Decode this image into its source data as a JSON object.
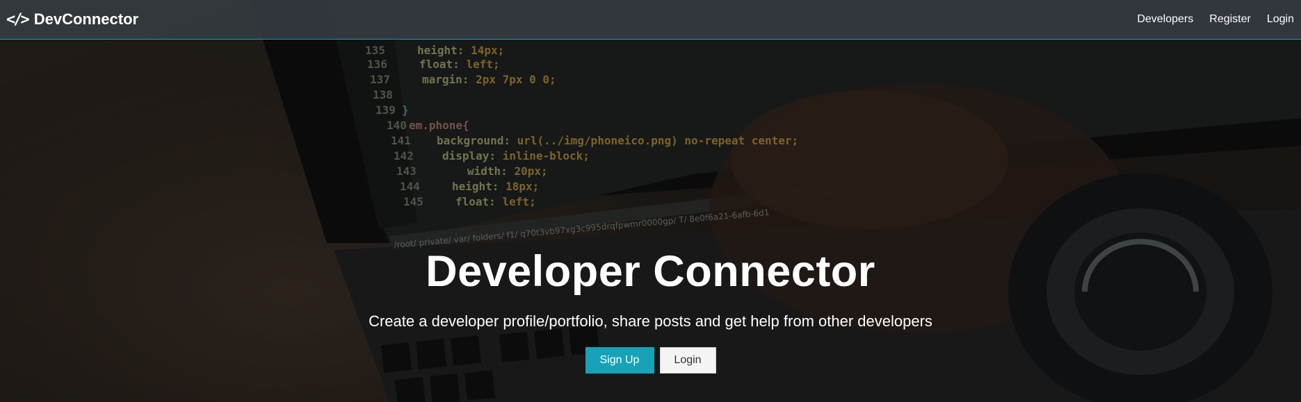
{
  "navbar": {
    "brand_icon": "</>",
    "brand_text": "DevConnector",
    "links": [
      "Developers",
      "Register",
      "Login"
    ]
  },
  "hero": {
    "title": "Developer Connector",
    "subtitle": "Create a developer profile/portfolio, share posts and get help from other developers",
    "buttons": {
      "signup": "Sign Up",
      "login": "Login"
    }
  },
  "background": {
    "code_lines": [
      {
        "num": "135",
        "text": "height: 14px;"
      },
      {
        "num": "136",
        "text": "float: left;"
      },
      {
        "num": "137",
        "text": "margin: 2px 7px 0 0;"
      },
      {
        "num": "138",
        "text": ""
      },
      {
        "num": "139",
        "text": "}"
      },
      {
        "num": "140",
        "text": "em.phone{"
      },
      {
        "num": "141",
        "text": "background: url(../img/phoneico.png) no-repeat center;"
      },
      {
        "num": "142",
        "text": "display: inline-block;"
      },
      {
        "num": "143",
        "text": "width: 20px;"
      },
      {
        "num": "144",
        "text": "height: 18px;"
      },
      {
        "num": "145",
        "text": "float: left;"
      }
    ],
    "status_bar": "/root/ private/ var/ folders/ f1/ q70t3vb97xg3c995drqfpwmr0000gp/ T/ 8e0f6a21-6afb-6d1",
    "colors": {
      "accent": "#17a2b8",
      "navbar": "#343a40"
    }
  }
}
